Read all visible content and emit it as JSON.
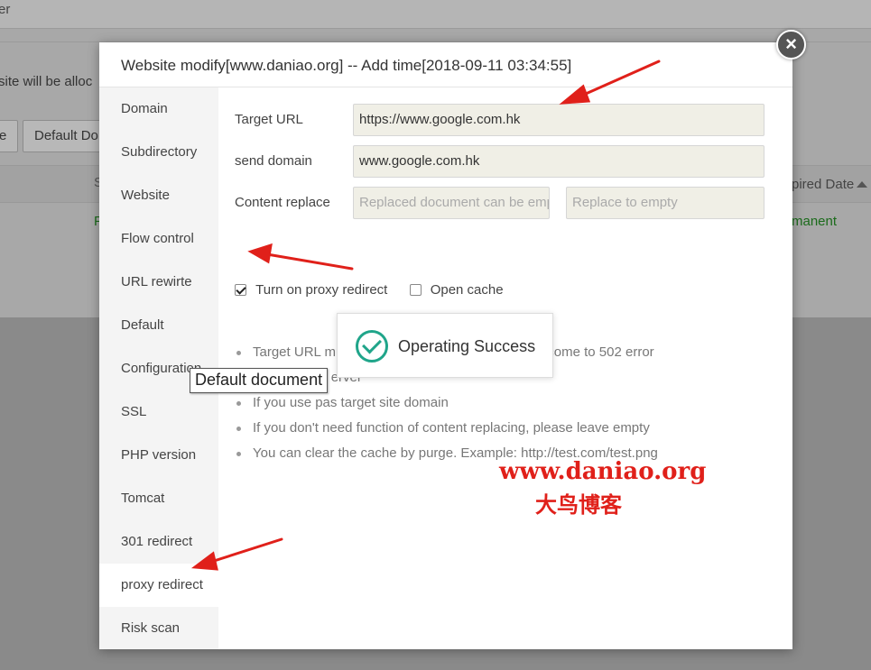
{
  "background": {
    "topbar_fragment": "er",
    "note_fragment": "site will be alloc",
    "buttons": [
      "e",
      "Default Do"
    ],
    "col_header": "Expired Date",
    "col_header_partial": "pired Date",
    "col_s": "S",
    "row_status": "F",
    "row_expire": "rmanent"
  },
  "modal": {
    "title": "Website modify[www.daniao.org] -- Add time[2018-09-11 03:34:55]",
    "close_symbol": "×",
    "sidebar": [
      {
        "label": "Domain"
      },
      {
        "label": "Subdirectory"
      },
      {
        "label": "Website"
      },
      {
        "label": "Flow control"
      },
      {
        "label": "URL rewirte"
      },
      {
        "label": "Default"
      },
      {
        "label": "Configuration"
      },
      {
        "label": "SSL"
      },
      {
        "label": "PHP version"
      },
      {
        "label": "Tomcat"
      },
      {
        "label": "301 redirect"
      },
      {
        "label": "proxy redirect",
        "active": true
      },
      {
        "label": "Risk scan"
      }
    ],
    "form": {
      "target_url_label": "Target URL",
      "target_url_value": "https://www.google.com.hk",
      "send_domain_label": "send domain",
      "send_domain_value": "www.google.com.hk",
      "content_replace_label": "Content replace",
      "replaced_placeholder": "Replaced document can be empty",
      "replace_to_placeholder": "Replace to empty"
    },
    "options": {
      "proxy_redirect_label": "Turn on proxy redirect",
      "proxy_redirect_checked": true,
      "open_cache_label": "Open cache",
      "open_cache_checked": false
    },
    "tips": [
      "Target URL must be able to access, ohterwise become to 502 error",
      "All of default                                            erver",
      "If you use pas                                           target site domain",
      "If you don't need function of content replacing, please leave empty",
      "You can clear the cache by purge. Example: http://test.com/test.png"
    ]
  },
  "toast": {
    "text": "Operating Success",
    "icon": "check-circle-icon",
    "color": "#20a58a"
  },
  "tooltip": {
    "text": "Default document"
  },
  "watermark": {
    "line1": "www.daniao.org",
    "line2": "大鸟博客",
    "color": "#e0201a"
  }
}
